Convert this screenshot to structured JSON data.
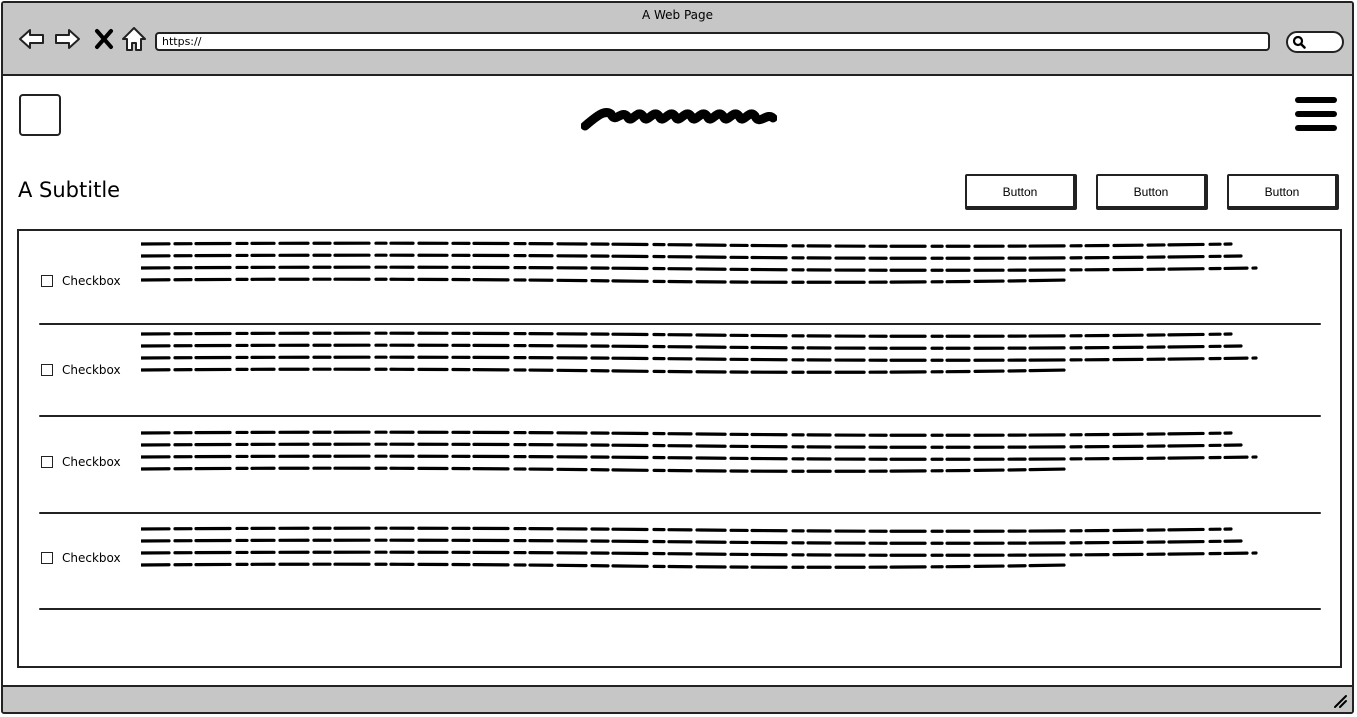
{
  "window": {
    "title": "A Web Page"
  },
  "toolbar": {
    "url": "https://"
  },
  "header": {
    "subtitle": "A Subtitle"
  },
  "actions": {
    "buttons": [
      "Button",
      "Button",
      "Button"
    ]
  },
  "list": {
    "items": [
      {
        "label": "Checkbox",
        "checked": false
      },
      {
        "label": "Checkbox",
        "checked": false
      },
      {
        "label": "Checkbox",
        "checked": false
      },
      {
        "label": "Checkbox",
        "checked": false
      }
    ]
  },
  "icons": {
    "back": "back-arrow-icon",
    "forward": "forward-arrow-icon",
    "stop": "close-icon",
    "home": "home-icon",
    "search": "search-icon",
    "menu": "hamburger-menu-icon",
    "resize": "resize-grip-icon"
  },
  "colors": {
    "chrome": "#c6c6c6",
    "ink": "#222222",
    "background": "#ffffff"
  }
}
